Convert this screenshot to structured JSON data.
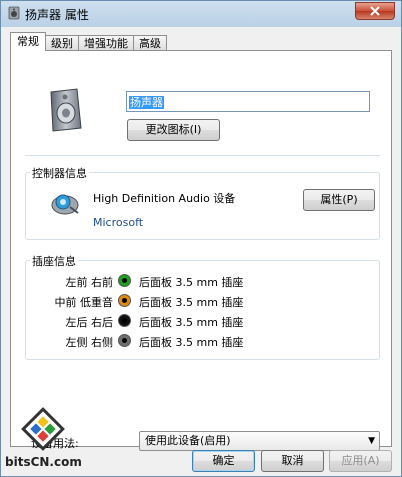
{
  "window": {
    "title": "扬声器 属性"
  },
  "tabs": [
    {
      "label": "常规",
      "active": true
    },
    {
      "label": "级别",
      "active": false
    },
    {
      "label": "增强功能",
      "active": false
    },
    {
      "label": "高级",
      "active": false
    }
  ],
  "general": {
    "device_name_value": "扬声器",
    "change_icon_label": "更改图标(I)"
  },
  "controller": {
    "group_title": "控制器信息",
    "device_name": "High Definition Audio 设备",
    "vendor": "Microsoft",
    "properties_label": "属性(P)"
  },
  "jack": {
    "group_title": "插座信息",
    "rows": [
      {
        "label": "左前 右前",
        "color": "#1aa11a",
        "text": "后面板 3.5 mm 插座"
      },
      {
        "label": "中前 低重音",
        "color": "#e08a12",
        "text": "后面板 3.5 mm 插座"
      },
      {
        "label": "左后 右后",
        "color": "#111111",
        "text": "后面板 3.5 mm 插座"
      },
      {
        "label": "左侧 右侧",
        "color": "#6e6e6e",
        "text": "后面板 3.5 mm 插座"
      }
    ]
  },
  "usage": {
    "label": "设备用法:",
    "selected": "使用此设备(启用)"
  },
  "footer": {
    "ok_label": "确定",
    "cancel_label": "取消",
    "apply_label": "应用(A)"
  },
  "watermark": {
    "text": "bitsCN.com"
  }
}
